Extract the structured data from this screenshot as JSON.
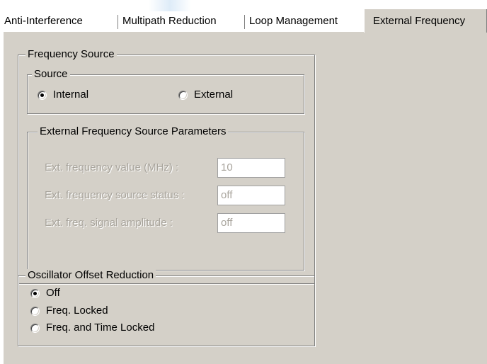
{
  "tabs": [
    {
      "label": "Anti-Interference"
    },
    {
      "label": "Multipath Reduction"
    },
    {
      "label": "Loop Management"
    },
    {
      "label": "External Frequency"
    }
  ],
  "frequency_source": {
    "title": "Frequency Source",
    "source": {
      "title": "Source",
      "internal_label": "Internal",
      "external_label": "External",
      "selected": "Internal"
    },
    "ext_params": {
      "title": "External Frequency Source Parameters",
      "freq_value_label": "Ext. frequency value (MHz) :",
      "freq_value": "10",
      "status_label": "Ext. frequency source status :",
      "status_value": "off",
      "amplitude_label": "Ext. freq. signal amplitude :",
      "amplitude_value": "off"
    }
  },
  "oscillator": {
    "title": "Oscillator Offset Reduction",
    "options": [
      {
        "label": "Off"
      },
      {
        "label": "Freq. Locked"
      },
      {
        "label": "Freq. and Time Locked"
      }
    ],
    "selected": "Off"
  }
}
